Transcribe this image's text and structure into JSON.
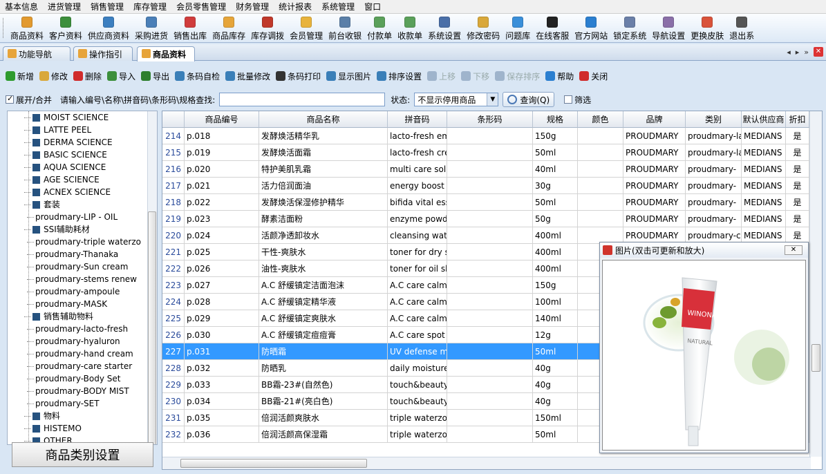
{
  "menubar": [
    "基本信息",
    "进货管理",
    "销售管理",
    "库存管理",
    "会员零售管理",
    "财务管理",
    "统计报表",
    "系统管理",
    "窗口"
  ],
  "toolbar": [
    {
      "label": "商品资料",
      "icon": "goods-icon",
      "color": "#e29a2f"
    },
    {
      "label": "客户资料",
      "icon": "customer-icon",
      "color": "#3c8f3c"
    },
    {
      "label": "供应商资料",
      "icon": "supplier-icon",
      "color": "#3c7fc0"
    },
    {
      "label": "采购进货",
      "icon": "purchase-icon",
      "color": "#4a7fb8"
    },
    {
      "label": "销售出库",
      "icon": "sales-icon",
      "color": "#d03c3c"
    },
    {
      "label": "商品库存",
      "icon": "stock-icon",
      "color": "#e6a53a"
    },
    {
      "label": "库存调拨",
      "icon": "transfer-icon",
      "color": "#c0392b"
    },
    {
      "label": "会员管理",
      "icon": "member-icon",
      "color": "#e8b33c"
    },
    {
      "label": "前台收银",
      "icon": "cashier-icon",
      "color": "#5a7fa8"
    },
    {
      "label": "付款单",
      "icon": "payment-icon",
      "color": "#5aa05a"
    },
    {
      "label": "收款单",
      "icon": "receipt-icon",
      "color": "#5aa05a"
    },
    {
      "label": "系统设置",
      "icon": "settings-icon",
      "color": "#4a6fa8"
    },
    {
      "label": "修改密码",
      "icon": "key-icon",
      "color": "#d9a83a"
    },
    {
      "label": "问题库",
      "icon": "question-icon",
      "color": "#3a8fd9"
    },
    {
      "label": "在线客服",
      "icon": "qq-icon",
      "color": "#222222"
    },
    {
      "label": "官方网站",
      "icon": "ie-icon",
      "color": "#2b7fd0"
    },
    {
      "label": "锁定系统",
      "icon": "lock-icon",
      "color": "#6a7fa8"
    },
    {
      "label": "导航设置",
      "icon": "nav-icon",
      "color": "#8a6fa8"
    },
    {
      "label": "更换皮肤",
      "icon": "skin-icon",
      "color": "#d9533a"
    },
    {
      "label": "退出系",
      "icon": "exit-icon",
      "color": "#555555"
    }
  ],
  "tabs": [
    {
      "label": "功能导航",
      "active": false
    },
    {
      "label": "操作指引",
      "active": false
    },
    {
      "label": "商品资料",
      "active": true
    }
  ],
  "actions": [
    {
      "label": "新增",
      "icon": "add-icon",
      "color": "#2e9b2e",
      "enabled": true
    },
    {
      "label": "修改",
      "icon": "edit-icon",
      "color": "#d9a83a",
      "enabled": true
    },
    {
      "label": "删除",
      "icon": "delete-icon",
      "color": "#d02b2b",
      "enabled": true
    },
    {
      "label": "导入",
      "icon": "import-icon",
      "color": "#3c8f3c",
      "enabled": true
    },
    {
      "label": "导出",
      "icon": "export-icon",
      "color": "#2e7f2e",
      "enabled": true
    },
    {
      "label": "条码自检",
      "icon": "barcode-check-icon",
      "color": "#3a7fb8",
      "enabled": true
    },
    {
      "label": "批量修改",
      "icon": "batch-edit-icon",
      "color": "#3a7fb8",
      "enabled": true
    },
    {
      "label": "条码打印",
      "icon": "barcode-print-icon",
      "color": "#333333",
      "enabled": true
    },
    {
      "label": "显示图片",
      "icon": "grid-icon",
      "color": "#3a7fb8",
      "enabled": true
    },
    {
      "label": "排序设置",
      "icon": "sort-icon",
      "color": "#3a7fb8",
      "enabled": true
    },
    {
      "label": "上移",
      "icon": "move-up-icon",
      "color": "#9fb4cc",
      "enabled": false
    },
    {
      "label": "下移",
      "icon": "move-down-icon",
      "color": "#9fb4cc",
      "enabled": false
    },
    {
      "label": "保存排序",
      "icon": "save-icon",
      "color": "#9fb4cc",
      "enabled": false
    },
    {
      "label": "帮助",
      "icon": "help-icon",
      "color": "#2b7fd0",
      "enabled": true
    },
    {
      "label": "关闭",
      "icon": "close-icon",
      "color": "#d02b2b",
      "enabled": true
    }
  ],
  "search": {
    "expand_label": "展开/合并",
    "expand_checked": true,
    "prompt": "请输入编号\\名称\\拼音码\\条形码\\规格查找:",
    "value": "",
    "status_label": "状态:",
    "status_value": "不显示停用商品",
    "query_label": "查询(Q)",
    "filter_label": "筛选",
    "filter_checked": false
  },
  "tree": [
    {
      "label": "MOIST SCIENCE",
      "type": "node"
    },
    {
      "label": "LATTE PEEL",
      "type": "node"
    },
    {
      "label": "DERMA SCIENCE",
      "type": "node"
    },
    {
      "label": "BASIC SCIENCE",
      "type": "node"
    },
    {
      "label": "AQUA SCIENCE",
      "type": "node"
    },
    {
      "label": "AGE SCIENCE",
      "type": "node"
    },
    {
      "label": "ACNEX SCIENCE",
      "type": "node"
    },
    {
      "label": "套装",
      "type": "node"
    },
    {
      "label": "proudmary-LIP - OIL",
      "type": "leaf"
    },
    {
      "label": "SSI辅助耗材",
      "type": "node"
    },
    {
      "label": "proudmary-triple waterzo",
      "type": "leaf"
    },
    {
      "label": "proudmary-Thanaka",
      "type": "leaf"
    },
    {
      "label": "proudmary-Sun  cream",
      "type": "leaf"
    },
    {
      "label": "proudmary-stems renew",
      "type": "leaf"
    },
    {
      "label": "proudmary-ampoule",
      "type": "leaf"
    },
    {
      "label": "proudmary-MASK",
      "type": "leaf"
    },
    {
      "label": "销售辅助物料",
      "type": "node"
    },
    {
      "label": "proudmary-lacto-fresh",
      "type": "leaf"
    },
    {
      "label": "proudmary-hyaluron",
      "type": "leaf"
    },
    {
      "label": "proudmary-hand cream",
      "type": "leaf"
    },
    {
      "label": "proudmary-care starter",
      "type": "leaf"
    },
    {
      "label": "proudmary-Body Set",
      "type": "leaf"
    },
    {
      "label": "proudmary-BODY MIST",
      "type": "leaf"
    },
    {
      "label": "proudmary-SET",
      "type": "leaf"
    },
    {
      "label": "物料",
      "type": "node"
    },
    {
      "label": "HISTEMO",
      "type": "node"
    },
    {
      "label": "OTHER",
      "type": "node"
    }
  ],
  "category_button": "商品类别设置",
  "columns": [
    "",
    "商品编号",
    "商品名称",
    "拼音码",
    "条形码",
    "规格",
    "颜色",
    "品牌",
    "类别",
    "默认供应商",
    "折扣"
  ],
  "rows": [
    [
      "214",
      "p.018",
      "发酵焕活精华乳",
      "lacto-fresh emul",
      "",
      "150g",
      "",
      "PROUDMARY",
      "proudmary-lac",
      "MEDIANS",
      "是"
    ],
    [
      "215",
      "p.019",
      "发酵焕活面霜",
      "lacto-fresh crear",
      "",
      "50ml",
      "",
      "PROUDMARY",
      "proudmary-lac",
      "MEDIANS",
      "是"
    ],
    [
      "216",
      "p.020",
      "特护美肌乳霜",
      "multi care soluti",
      "",
      "40ml",
      "",
      "PROUDMARY",
      "proudmary-",
      "MEDIANS",
      "是"
    ],
    [
      "217",
      "p.021",
      "活力倍润面油",
      "energy boost fac",
      "",
      "30g",
      "",
      "PROUDMARY",
      "proudmary-",
      "MEDIANS",
      "是"
    ],
    [
      "218",
      "p.022",
      "发酵焕活保湿修护精华",
      "bifida vital esser",
      "",
      "50ml",
      "",
      "PROUDMARY",
      "proudmary-",
      "MEDIANS",
      "是"
    ],
    [
      "219",
      "p.023",
      "酵素洁面粉",
      "enzyme powder",
      "",
      "50g",
      "",
      "PROUDMARY",
      "proudmary-",
      "MEDIANS",
      "是"
    ],
    [
      "220",
      "p.024",
      "活颜净透卸妆水",
      "cleansing water",
      "",
      "400ml",
      "",
      "PROUDMARY",
      "proudmary-ca",
      "MEDIANS",
      "是"
    ],
    [
      "221",
      "p.025",
      "干性-爽肤水",
      "toner for dry skir",
      "",
      "400ml",
      "",
      "",
      "",
      "",
      ""
    ],
    [
      "222",
      "p.026",
      "油性-爽肤水",
      "toner for oil skin",
      "",
      "400ml",
      "",
      "",
      "",
      "",
      ""
    ],
    [
      "223",
      "p.027",
      "A.C 舒缓镇定洁面泡沫",
      "A.C care calming",
      "",
      "150g",
      "",
      "",
      "",
      "",
      ""
    ],
    [
      "224",
      "p.028",
      "A.C 舒缓镇定精华液",
      "A.C care calming",
      "",
      "100ml",
      "",
      "",
      "",
      "",
      ""
    ],
    [
      "225",
      "p.029",
      "A.C 舒缓镇定爽肤水",
      "A.C care calming",
      "",
      "140ml",
      "",
      "",
      "",
      "",
      ""
    ],
    [
      "226",
      "p.030",
      "A.C 舒缓镇定痘痘膏",
      "A.C care spot so",
      "",
      "12g",
      "",
      "",
      "",
      "",
      ""
    ],
    [
      "227",
      "p.031",
      "防晒霜",
      "UV defense mild",
      "",
      "50ml",
      "",
      "",
      "",
      "",
      ""
    ],
    [
      "228",
      "p.032",
      "防晒乳",
      "daily moisture s",
      "",
      "40g",
      "",
      "",
      "",
      "",
      ""
    ],
    [
      "229",
      "p.033",
      "BB霜-23#(自然色)",
      "touch&beauty BB",
      "",
      "40g",
      "",
      "",
      "",
      "",
      ""
    ],
    [
      "230",
      "p.034",
      "BB霜-21#(亮白色)",
      "touch&beauty BE",
      "",
      "40g",
      "",
      "",
      "",
      "",
      ""
    ],
    [
      "231",
      "p.035",
      "倍润活颜爽肤水",
      "triple waterzone",
      "",
      "150ml",
      "",
      "",
      "",
      "",
      ""
    ],
    [
      "232",
      "p.036",
      "倍润活颜高保湿霜",
      "triple waterzone",
      "",
      "50ml",
      "",
      "",
      "",
      "",
      ""
    ]
  ],
  "selected_row": "227",
  "image_window": {
    "title": "图片(双击可更新和放大)",
    "product_brand": "WINONA",
    "product_line": "NATURAL"
  }
}
